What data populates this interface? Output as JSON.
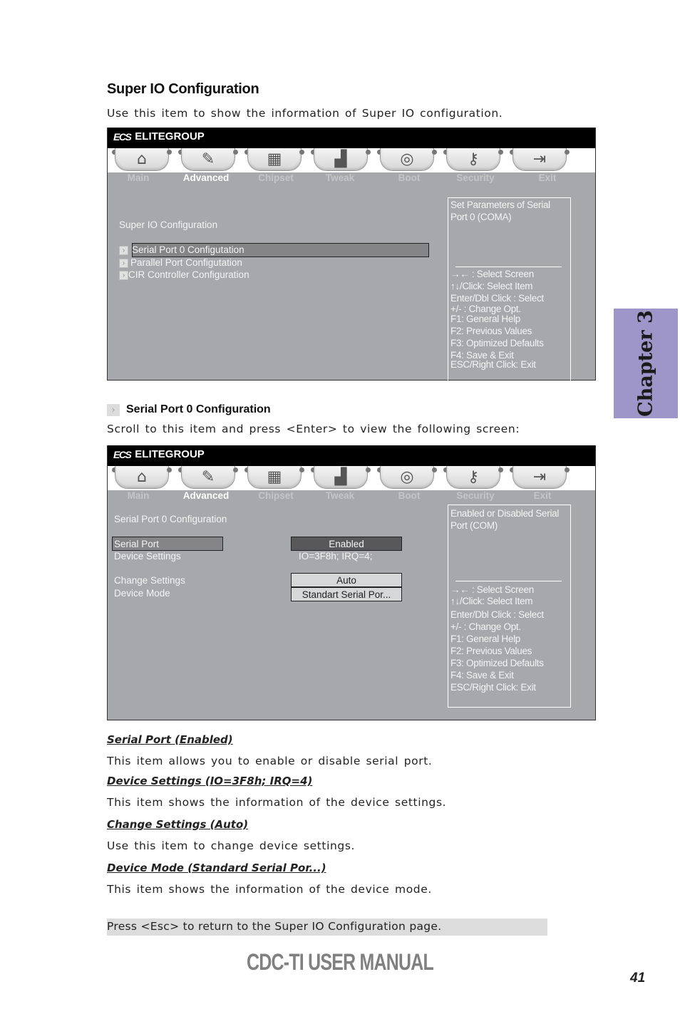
{
  "section": {
    "title": "Super IO Configuration",
    "description": "Use this item to show the information of Super IO configuration."
  },
  "bios_brand": {
    "logo": "ECS",
    "name": "ELITEGROUP"
  },
  "tabs": [
    {
      "label": "Main",
      "icon": "home-icon",
      "glyph": "⌂"
    },
    {
      "label": "Advanced",
      "icon": "wrench-icon",
      "glyph": "🔧",
      "active": true
    },
    {
      "label": "Chipset",
      "icon": "chip-icon",
      "glyph": "▦"
    },
    {
      "label": "Tweak",
      "icon": "chart-icon",
      "glyph": "📈"
    },
    {
      "label": "Boot",
      "icon": "power-icon",
      "glyph": "⏻"
    },
    {
      "label": "Security",
      "icon": "key-icon",
      "glyph": "⚷"
    },
    {
      "label": "Exit",
      "icon": "exit-icon",
      "glyph": "⇥"
    }
  ],
  "screen1": {
    "heading": "Super IO Configuration",
    "items": [
      {
        "label": "Serial Port 0 Configutation",
        "selected": true
      },
      {
        "label": "Parallel Port Configutation"
      },
      {
        "label": "CIR Controller Configuration"
      }
    ],
    "help_text": [
      "Set Parameters of Serial",
      "Port 0 (COMA)"
    ]
  },
  "help_keys": [
    "→←   : Select Screen",
    "↑↓/Click: Select Item",
    "Enter/Dbl Click : Select",
    "+/- : Change Opt.",
    "F1: General Help",
    "F2: Previous Values",
    "F3: Optimized Defaults",
    "F4: Save & Exit",
    "ESC/Right Click: Exit"
  ],
  "subsection": {
    "title": "Serial Port 0 Configuration",
    "description": "Scroll to this item and press <Enter> to view the following screen:"
  },
  "screen2": {
    "heading": "Serial Port 0 Configuration",
    "rows": [
      {
        "label": "Serial Port",
        "value": "Enabled"
      },
      {
        "label": "Device Settings",
        "value": "IO=3F8h; IRQ=4;"
      },
      {
        "label": "Change Settings",
        "value": "Auto"
      },
      {
        "label": "Device Mode",
        "value": "Standart Serial Por..."
      }
    ],
    "help_text": [
      "Enabled or Disabled Serial",
      "Port (COM)"
    ]
  },
  "items": [
    {
      "title": "Serial Port (Enabled)",
      "desc": "This item allows you to enable or disable serial port."
    },
    {
      "title": "Device Settings (IO=3F8h; IRQ=4)",
      "desc": "This item shows the information of the device settings."
    },
    {
      "title": "Change Settings (Auto)",
      "desc": "Use this item to change device settings."
    },
    {
      "title": "Device Mode (Standard Serial Por...)",
      "desc": "This item shows the information of the device mode."
    }
  ],
  "note": "Press <Esc> to return to the Super IO Configuration page.",
  "chapter_tab": "Chapter 3",
  "footer": "CDC-TI USER MANUAL",
  "page_number": "41"
}
